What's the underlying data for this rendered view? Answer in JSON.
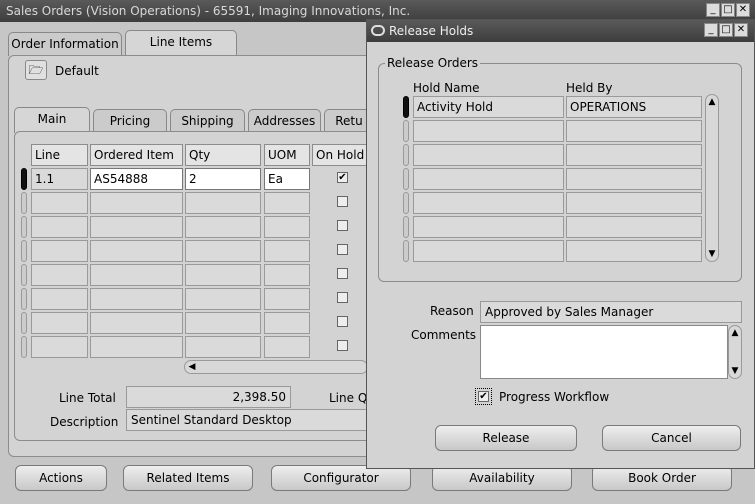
{
  "main_window": {
    "title": "Sales Orders (Vision Operations) - 65591, Imaging Innovations, Inc.",
    "tabs": [
      "Order Information",
      "Line Items"
    ],
    "default_label": "Default",
    "subtabs": [
      "Main",
      "Pricing",
      "Shipping",
      "Addresses",
      "Retu"
    ],
    "table": {
      "headers": [
        "Line",
        "Ordered Item",
        "Qty",
        "UOM",
        "On Hold"
      ],
      "rows": [
        {
          "line": "1.1",
          "item": "AS54888",
          "qty": "2",
          "uom": "Ea",
          "on_hold": true
        }
      ],
      "checkbox_mark": "✔"
    },
    "line_total_label": "Line Total",
    "line_total_value": "2,398.50",
    "line_qty_label": "Line Q",
    "description_label": "Description",
    "description_value": "Sentinel Standard Desktop",
    "buttons": {
      "actions": "Actions",
      "related_items": "Related Items",
      "configurator": "Configurator",
      "availability": "Availability",
      "book_order": "Book Order"
    }
  },
  "dialog": {
    "title": "Release Holds",
    "group_label": "Release Orders",
    "headers": [
      "Hold Name",
      "Held By"
    ],
    "rows": [
      {
        "hold_name": "Activity Hold",
        "held_by": "OPERATIONS"
      }
    ],
    "reason_label": "Reason",
    "reason_value": "Approved by Sales Manager",
    "comments_label": "Comments",
    "progress_workflow_label": "Progress Workflow",
    "progress_workflow_checked": true,
    "release_button": "Release",
    "cancel_button": "Cancel"
  }
}
